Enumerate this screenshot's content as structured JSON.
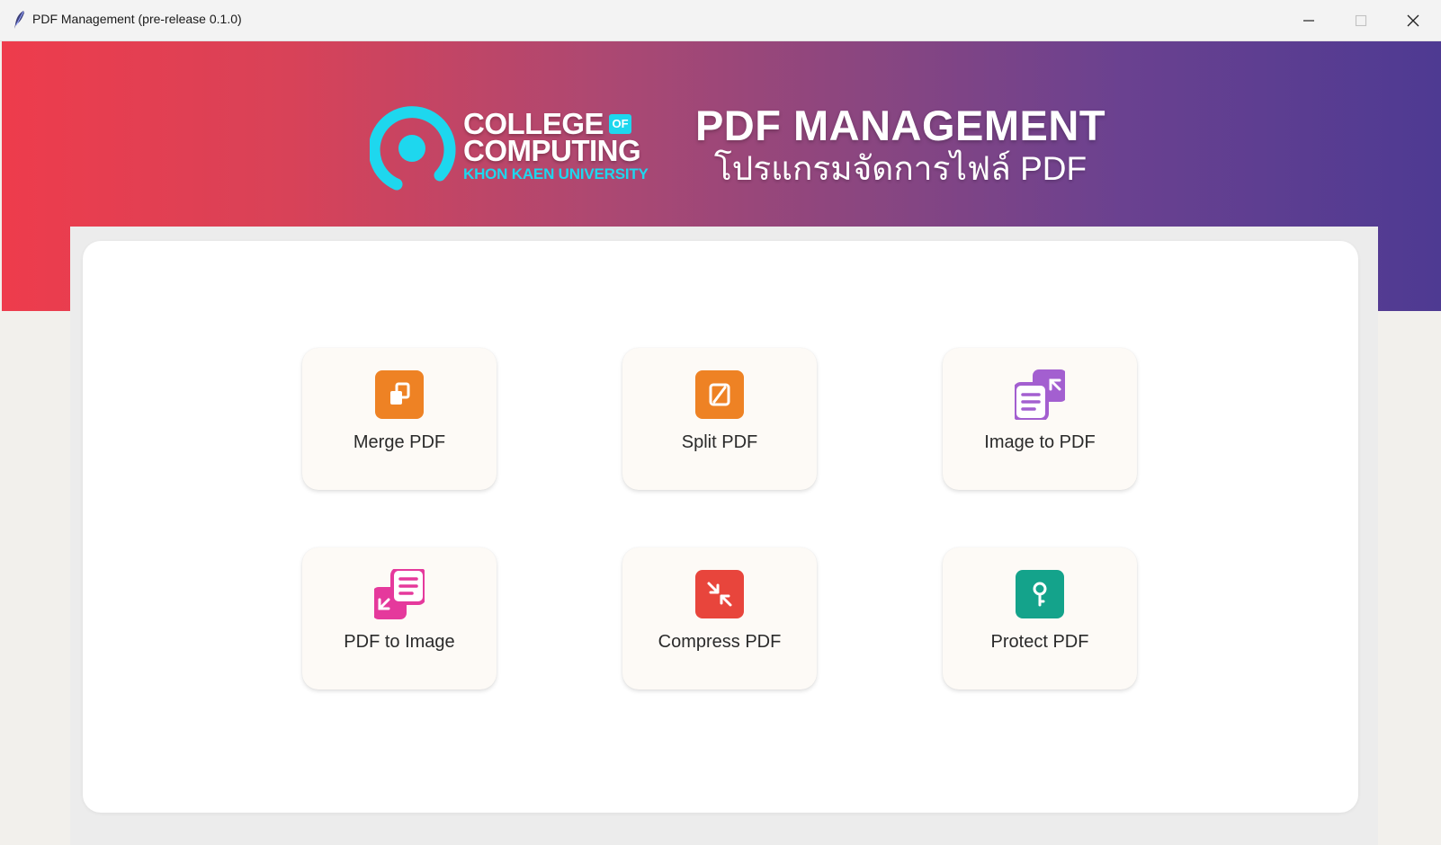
{
  "window": {
    "title": "PDF Management (pre-release 0.1.0)",
    "controls": [
      "minimize-icon",
      "maximize-icon",
      "close-icon"
    ]
  },
  "header": {
    "logo": {
      "line1": "COLLEGE",
      "of": "OF",
      "line2": "COMPUTING",
      "line3": "KHON KAEN UNIVERSITY"
    },
    "title": "PDF MANAGEMENT",
    "subtitle": "โปรแกรมจัดการไฟล์ PDF"
  },
  "colors": {
    "banner_start": "#ee3c4c",
    "banner_end": "#4e3a92",
    "logo_cyan": "#1ed7ee",
    "merge": "#ee8224",
    "split": "#ee8224",
    "image_to_pdf": "#a35fd0",
    "pdf_to_image": "#e5399c",
    "compress": "#e8453c",
    "protect": "#14a38b"
  },
  "tools": [
    {
      "label": "Merge PDF",
      "icon": "merge-icon"
    },
    {
      "label": "Split PDF",
      "icon": "split-icon"
    },
    {
      "label": "Image to PDF",
      "icon": "image-to-pdf-icon"
    },
    {
      "label": "PDF to Image",
      "icon": "pdf-to-image-icon"
    },
    {
      "label": "Compress PDF",
      "icon": "compress-icon"
    },
    {
      "label": "Protect PDF",
      "icon": "protect-icon"
    }
  ]
}
